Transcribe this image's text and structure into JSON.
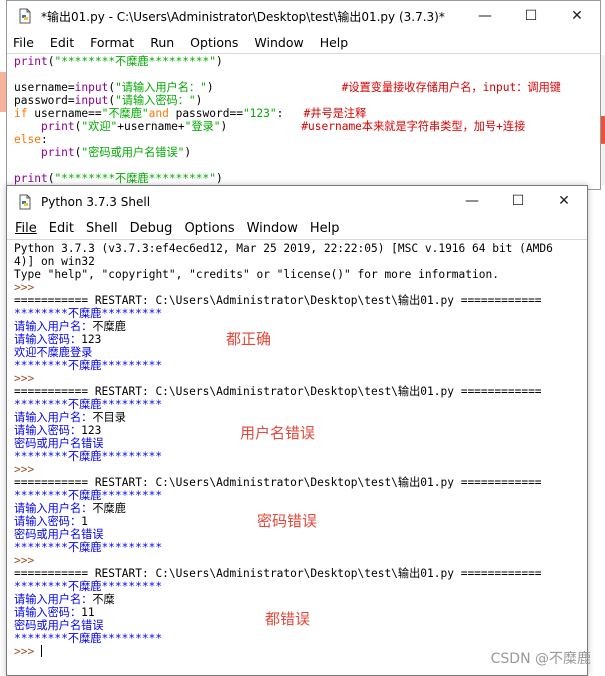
{
  "editor": {
    "title": "*输出01.py - C:\\Users\\Administrator\\Desktop\\test\\输出01.py (3.7.3)*",
    "menu": [
      "File",
      "Edit",
      "Format",
      "Run",
      "Options",
      "Window",
      "Help"
    ],
    "lines": [
      [
        {
          "t": "print",
          "c": "bi"
        },
        {
          "t": "(",
          "c": "sys"
        },
        {
          "t": "\"********不糜鹿*********\"",
          "c": "str"
        },
        {
          "t": ")",
          "c": "sys"
        }
      ],
      [],
      [
        {
          "t": "username=",
          "c": "sys"
        },
        {
          "t": "input",
          "c": "bi"
        },
        {
          "t": "(",
          "c": "sys"
        },
        {
          "t": "\"请输入用户名：\"",
          "c": "str"
        },
        {
          "t": ")                   ",
          "c": "sys"
        },
        {
          "t": "#设置变量接收存储用户名，input：调用键",
          "c": "cm"
        }
      ],
      [
        {
          "t": "password=",
          "c": "sys"
        },
        {
          "t": "input",
          "c": "bi"
        },
        {
          "t": "(",
          "c": "sys"
        },
        {
          "t": "\"请输入密码：\"",
          "c": "str"
        },
        {
          "t": ")",
          "c": "sys"
        }
      ],
      [
        {
          "t": "if",
          "c": "kw"
        },
        {
          "t": " username==",
          "c": "sys"
        },
        {
          "t": "\"不糜鹿\"",
          "c": "str"
        },
        {
          "t": "and",
          "c": "kw"
        },
        {
          "t": " password==",
          "c": "sys"
        },
        {
          "t": "\"123\"",
          "c": "str"
        },
        {
          "t": ":   ",
          "c": "sys"
        },
        {
          "t": "#井号是注释",
          "c": "cm"
        }
      ],
      [
        {
          "t": "    ",
          "c": "sys"
        },
        {
          "t": "print",
          "c": "bi"
        },
        {
          "t": "(",
          "c": "sys"
        },
        {
          "t": "\"欢迎\"",
          "c": "str"
        },
        {
          "t": "+username+",
          "c": "sys"
        },
        {
          "t": "\"登录\"",
          "c": "str"
        },
        {
          "t": ")           ",
          "c": "sys"
        },
        {
          "t": "#username本来就是字符串类型，加号+连接",
          "c": "cm"
        }
      ],
      [
        {
          "t": "else",
          "c": "kw"
        },
        {
          "t": ":",
          "c": "sys"
        }
      ],
      [
        {
          "t": "    ",
          "c": "sys"
        },
        {
          "t": "print",
          "c": "bi"
        },
        {
          "t": "(",
          "c": "sys"
        },
        {
          "t": "\"密码或用户名错误\"",
          "c": "str"
        },
        {
          "t": ")",
          "c": "sys"
        }
      ],
      [],
      [
        {
          "t": "print",
          "c": "bi"
        },
        {
          "t": "(",
          "c": "sys"
        },
        {
          "t": "\"********不糜鹿*********\"",
          "c": "str"
        },
        {
          "t": ")",
          "c": "sys"
        }
      ]
    ]
  },
  "shell": {
    "title": "Python 3.7.3 Shell",
    "menu": [
      "File",
      "Edit",
      "Shell",
      "Debug",
      "Options",
      "Window",
      "Help"
    ],
    "lines": [
      [
        {
          "t": "Python 3.7.3 (v3.7.3:ef4ec6ed12, Mar 25 2019, 22:22:05) [MSC v.1916 64 bit (AMD6",
          "c": "sys"
        }
      ],
      [
        {
          "t": "4)] on win32",
          "c": "sys"
        }
      ],
      [
        {
          "t": "Type \"help\", \"copyright\", \"credits\" or \"license()\" for more information.",
          "c": "sys"
        }
      ],
      [
        {
          "t": ">>> ",
          "c": "prompt"
        }
      ],
      [
        {
          "t": "=========== RESTART: C:\\Users\\Administrator\\Desktop\\test\\输出01.py ============",
          "c": "sys"
        }
      ],
      [
        {
          "t": "********不糜鹿*********",
          "c": "out"
        }
      ],
      [
        {
          "t": "请输入用户名：",
          "c": "out"
        },
        {
          "t": "不糜鹿",
          "c": "in"
        }
      ],
      [
        {
          "t": "请输入密码：",
          "c": "out"
        },
        {
          "t": "123",
          "c": "in"
        }
      ],
      [
        {
          "t": "欢迎不糜鹿登录",
          "c": "out"
        }
      ],
      [
        {
          "t": "********不糜鹿*********",
          "c": "out"
        }
      ],
      [
        {
          "t": ">>> ",
          "c": "prompt"
        }
      ],
      [
        {
          "t": "=========== RESTART: C:\\Users\\Administrator\\Desktop\\test\\输出01.py ============",
          "c": "sys"
        }
      ],
      [
        {
          "t": "********不糜鹿*********",
          "c": "out"
        }
      ],
      [
        {
          "t": "请输入用户名：",
          "c": "out"
        },
        {
          "t": "不目录",
          "c": "in"
        }
      ],
      [
        {
          "t": "请输入密码：",
          "c": "out"
        },
        {
          "t": "123",
          "c": "in"
        }
      ],
      [
        {
          "t": "密码或用户名错误",
          "c": "out"
        }
      ],
      [
        {
          "t": "********不糜鹿*********",
          "c": "out"
        }
      ],
      [
        {
          "t": ">>> ",
          "c": "prompt"
        }
      ],
      [
        {
          "t": "=========== RESTART: C:\\Users\\Administrator\\Desktop\\test\\输出01.py ============",
          "c": "sys"
        }
      ],
      [
        {
          "t": "********不糜鹿*********",
          "c": "out"
        }
      ],
      [
        {
          "t": "请输入用户名：",
          "c": "out"
        },
        {
          "t": "不糜鹿",
          "c": "in"
        }
      ],
      [
        {
          "t": "请输入密码：",
          "c": "out"
        },
        {
          "t": "1",
          "c": "in"
        }
      ],
      [
        {
          "t": "密码或用户名错误",
          "c": "out"
        }
      ],
      [
        {
          "t": "********不糜鹿*********",
          "c": "out"
        }
      ],
      [
        {
          "t": ">>> ",
          "c": "prompt"
        }
      ],
      [
        {
          "t": "=========== RESTART: C:\\Users\\Administrator\\Desktop\\test\\输出01.py ============",
          "c": "sys"
        }
      ],
      [
        {
          "t": "********不糜鹿*********",
          "c": "out"
        }
      ],
      [
        {
          "t": "请输入用户名：",
          "c": "out"
        },
        {
          "t": "不糜",
          "c": "in"
        }
      ],
      [
        {
          "t": "请输入密码：",
          "c": "out"
        },
        {
          "t": "11",
          "c": "in"
        }
      ],
      [
        {
          "t": "密码或用户名错误",
          "c": "out"
        }
      ],
      [
        {
          "t": "********不糜鹿*********",
          "c": "out"
        }
      ],
      [
        {
          "t": ">>> ",
          "c": "prompt"
        }
      ]
    ]
  },
  "annotations": {
    "all_correct": "都正确",
    "username_wrong": "用户名错误",
    "password_wrong": "密码错误",
    "both_wrong": "都错误"
  },
  "watermark": "CSDN @不糜鹿",
  "icons": {
    "minimize": "minimize-icon",
    "maximize": "maximize-icon",
    "close": "close-icon",
    "app": "python-file-icon"
  },
  "colors": {
    "keyword": "#ff7700",
    "builtin": "#900090",
    "string": "#00aa00",
    "comment": "#dd0000",
    "stdout": "#0000ff",
    "annotation": "#e8473a"
  }
}
